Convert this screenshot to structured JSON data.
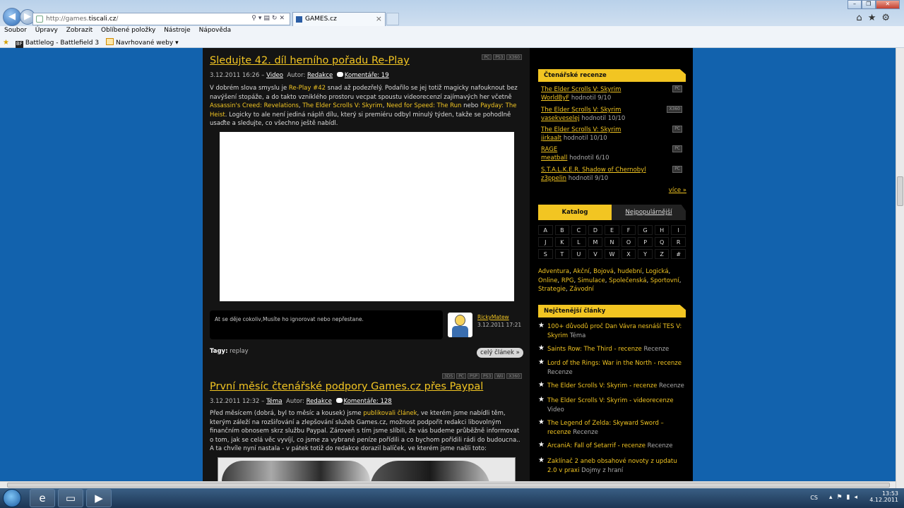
{
  "browser": {
    "url_prefix": "http://games.",
    "url_host": "tiscali.cz",
    "url_suffix": "/",
    "tab_title": "GAMES.cz",
    "menu": [
      "Soubor",
      "Úpravy",
      "Zobrazit",
      "Oblíbené položky",
      "Nástroje",
      "Nápověda"
    ],
    "fav_battlelog": "Battlelog - Battlefield 3",
    "fav_suggested": "Navrhované weby"
  },
  "article1": {
    "platforms": [
      "PC",
      "PS3",
      "X360"
    ],
    "title": "Sledujte 42. díl herního pořadu Re-Play",
    "date": "3.12.2011 16:26 –",
    "category": "Video",
    "author_label": "Autor:",
    "author": "Redakce",
    "comments": "Komentáře: 19",
    "p1": "V dobrém slova smyslu je ",
    "link_replay": "Re-Play #42",
    "p2": " snad až podezřelý. Podařilo se jej totiž magicky nafouknout bez navýšení stopáže, a do takto vzniklého prostoru vecpat spoustu videorecenzí zajímavých her včetně ",
    "link_ac": "Assassin's Creed: Revelations",
    "sep1": ", ",
    "link_skyrim": "The Elder Scrolls V: Skyrim",
    "sep2": ", ",
    "link_nfs": "Need for Speed: The Run",
    "sep3": " nebo ",
    "link_payday": "Payday: The Heist",
    "p3": ". Logicky to ale není jediná náplň dílu, který si premiéru odbyl minulý týden, takže se pohodlně usaďte a sledujte, co všechno ještě nabídl.",
    "comment_text": "At se děje cokoliv,Musíte ho ignorovat nebo nepřestane.",
    "comment_user": "RickyMatew",
    "comment_date": "3.12.2011 17:21",
    "tags_label": "Tagy:",
    "tag": "replay",
    "more": "celý článek »"
  },
  "article2": {
    "platforms": [
      "3DS",
      "PC",
      "PSP",
      "PS3",
      "Wii",
      "X360"
    ],
    "title": "První měsíc čtenářské podpory Games.cz přes Paypal",
    "date": "3.12.2011 12:32 –",
    "category": "Téma",
    "author_label": "Autor:",
    "author": "Redakce",
    "comments": "Komentáře: 128",
    "p1": "Před měsícem (dobrá, byl to měsíc a kousek) jsme ",
    "link": "publikovali článek",
    "p2": ", ve kterém jsme nabídli těm, kterým záleží na rozšiřování a zlepšování služeb Games.cz, možnost podpořit redakci libovolným finančním obnosem skrz službu Paypal. Zároveň s tím jsme slíbili, že vás budeme průběžně informovat o tom, jak se celá věc vyvíjí, co jsme za vybrané peníze pořídili a co bychom pořídili rádi do budoucna.. A ta chvíle nyní nastala - v pátek totiž do redakce dorazil balíček, ve kterém jsme našli toto:"
  },
  "sidebar": {
    "reviews_title": "Čtenářské recenze",
    "reviews": [
      {
        "game": "The Elder Scrolls V: Skyrim",
        "user": "WorldByF",
        "score": "hodnotil 9/10",
        "platform": "PC"
      },
      {
        "game": "The Elder Scrolls V: Skyrim",
        "user": "vasekveselej",
        "score": "hodnotil 10/10",
        "platform": "X360"
      },
      {
        "game": "The Elder Scrolls V: Skyrim",
        "user": "jirkaalt",
        "score": "hodnotil 10/10",
        "platform": "PC"
      },
      {
        "game": "RAGE",
        "user": "meatball",
        "score": "hodnotil 6/10",
        "platform": "PC"
      },
      {
        "game": "S.T.A.L.K.E.R. Shadow of Chernobyl",
        "user": "z3ppelin",
        "score": "hodnotil 9/10",
        "platform": "PC"
      }
    ],
    "more": "více »",
    "tab_catalog": "Katalog",
    "tab_popular": "Nejpopulárnější",
    "letters": [
      "A",
      "B",
      "C",
      "D",
      "E",
      "F",
      "G",
      "H",
      "I",
      "J",
      "K",
      "L",
      "M",
      "N",
      "O",
      "P",
      "Q",
      "R",
      "S",
      "T",
      "U",
      "V",
      "W",
      "X",
      "Y",
      "Z",
      "#"
    ],
    "genres": [
      "Adventura",
      "Akční",
      "Bojová",
      "hudební",
      "Logická",
      "Online",
      "RPG",
      "Simulace",
      "Společenská",
      "Sportovní",
      "Strategie",
      "Závodní"
    ],
    "top_title": "Nejčtenější články",
    "top": [
      {
        "link": "100+ důvodů proč Dan Vávra nesnáší TES V: Skyrim",
        "type": " Téma"
      },
      {
        "link": "Saints Row: The Third - recenze",
        "type": " Recenze"
      },
      {
        "link": "Lord of the Rings: War in the North - recenze",
        "type": " Recenze"
      },
      {
        "link": "The Elder Scrolls V: Skyrim - recenze",
        "type": " Recenze"
      },
      {
        "link": "The Elder Scrolls V: Skyrim - videorecenze",
        "type": " Video"
      },
      {
        "link": "The Legend of Zelda: Skyward Sword – recenze",
        "type": " Recenze"
      },
      {
        "link": "ArcaniA: Fall of Setarrif - recenze",
        "type": " Recenze"
      },
      {
        "link": "Zaklínač 2 aneb obsahové novoty z updatu 2.0 v praxi",
        "type": " Dojmy z hraní"
      }
    ]
  },
  "taskbar": {
    "lang": "CS",
    "time": "13:53",
    "date": "4.12.2011"
  }
}
